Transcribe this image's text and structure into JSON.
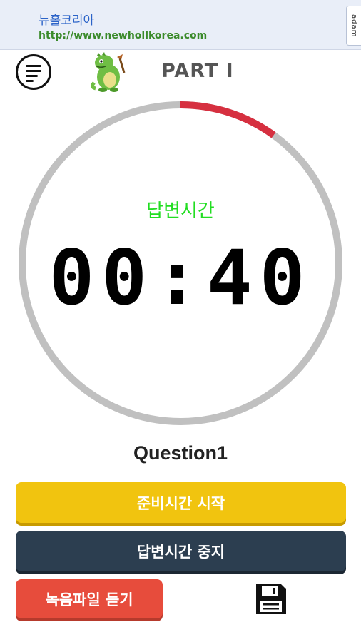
{
  "ad": {
    "title": "뉴홀코리아",
    "url": "http://www.newhollkorea.com",
    "badge": "adam"
  },
  "header": {
    "menu_icon": "menu-lines-icon",
    "mascot_icon": "dinosaur-mascot-icon",
    "title": "PART Ⅰ"
  },
  "timer": {
    "label": "답변시간",
    "display": "00:40",
    "progress_fraction": 0.1,
    "track_color": "#c0c0c0",
    "progress_color": "#d63040",
    "label_color": "#22dd22"
  },
  "question": {
    "label": "Question1"
  },
  "buttons": {
    "prep_start": "준비시간 시작",
    "answer_stop": "답변시간 중지",
    "listen_recording": "녹음파일 듣기",
    "save_icon": "floppy-disk-icon"
  },
  "colors": {
    "prep_button": "#f1c40f",
    "stop_button": "#2c3e50",
    "listen_button": "#e74c3c"
  }
}
